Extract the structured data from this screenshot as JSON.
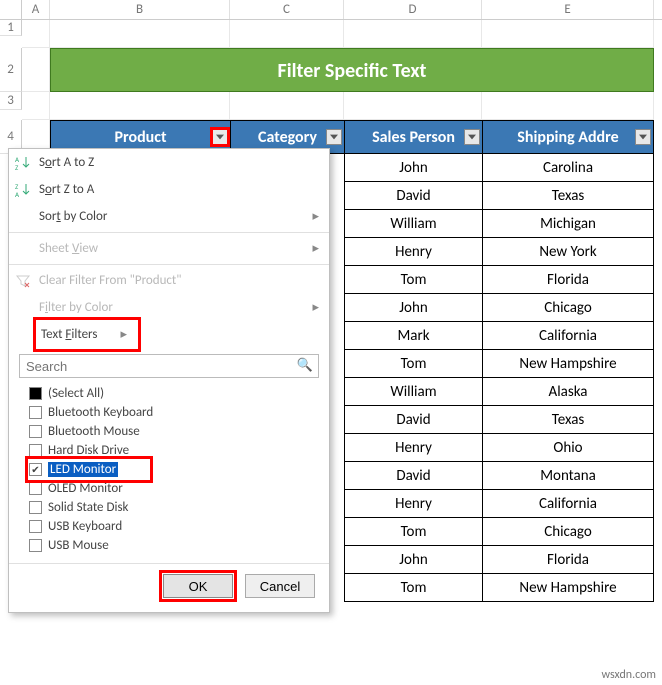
{
  "col_headers": {
    "A": "A",
    "B": "B",
    "C": "C",
    "D": "D",
    "E": "E"
  },
  "row_nums": [
    "1",
    "2",
    "3",
    "4"
  ],
  "title": "Filter Specific Text",
  "table": {
    "headers": {
      "product": "Product",
      "category": "Category",
      "person": "Sales Person",
      "addr": "Shipping Addre"
    },
    "rows": [
      {
        "person": "John",
        "addr": "Carolina"
      },
      {
        "person": "David",
        "addr": "Texas"
      },
      {
        "person": "William",
        "addr": "Michigan"
      },
      {
        "person": "Henry",
        "addr": "New York"
      },
      {
        "person": "Tom",
        "addr": "Florida"
      },
      {
        "person": "John",
        "addr": "Chicago"
      },
      {
        "person": "Mark",
        "addr": "California"
      },
      {
        "person": "Tom",
        "addr": "New Hampshire"
      },
      {
        "person": "William",
        "addr": "Alaska"
      },
      {
        "person": "David",
        "addr": "Texas"
      },
      {
        "person": "Henry",
        "addr": "Ohio"
      },
      {
        "person": "David",
        "addr": "Montana"
      },
      {
        "person": "Henry",
        "addr": "California"
      },
      {
        "person": "Tom",
        "addr": "Chicago"
      },
      {
        "person": "John",
        "addr": "Florida"
      },
      {
        "person": "Tom",
        "addr": "New Hampshire"
      }
    ]
  },
  "menu": {
    "sort_az": "Sort A to Z",
    "sort_za": "Sort Z to A",
    "sort_color": "Sort by Color",
    "sheet_view": "Sheet View",
    "clear": "Clear Filter From \"Product\"",
    "filter_color": "Filter by Color",
    "text_filters": "Text Filters",
    "search_ph": "Search",
    "items": {
      "select_all": "(Select All)",
      "bk": "Bluetooth Keyboard",
      "bm": "Bluetooth Mouse",
      "hdd": "Hard Disk Drive",
      "led": "LED Monitor",
      "oled": "OLED Monitor",
      "ssd": "Solid State Disk",
      "ukb": "USB Keyboard",
      "umouse": "USB Mouse"
    },
    "ok": "OK",
    "cancel": "Cancel"
  },
  "watermark": "wsxdn.com"
}
